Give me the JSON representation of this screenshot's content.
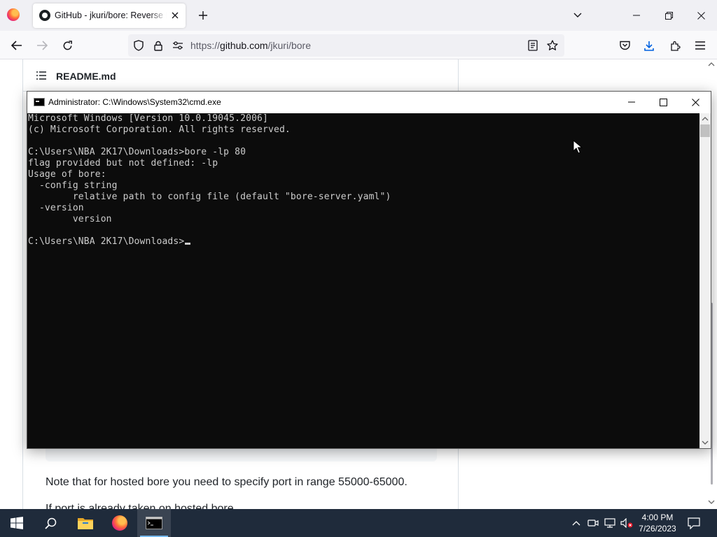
{
  "browser": {
    "tab": {
      "title": "GitHub - jkuri/bore: Reverse HTTP/TCP proxy"
    },
    "url": {
      "prefix": "https://",
      "host": "github.com",
      "path": "/jkuri/bore"
    }
  },
  "page": {
    "readme_title": "README.md",
    "note": "Note that for hosted bore you need to specify port in range 55000-65000.",
    "cut_text": "If port is already taken on hosted bore..."
  },
  "cmd": {
    "title": "Administrator: C:\\Windows\\System32\\cmd.exe",
    "lines": [
      "Microsoft Windows [Version 10.0.19045.2006]",
      "(c) Microsoft Corporation. All rights reserved.",
      "",
      "C:\\Users\\NBA 2K17\\Downloads>bore -lp 80",
      "flag provided but not defined: -lp",
      "Usage of bore:",
      "  -config string",
      "        relative path to config file (default \"bore-server.yaml\")",
      "  -version",
      "        version",
      "",
      "C:\\Users\\NBA 2K17\\Downloads>"
    ]
  },
  "taskbar": {
    "time": "4:00 PM",
    "date": "7/26/2023"
  },
  "colors": {
    "console_bg": "#0c0c0c",
    "console_text": "#cccccc",
    "taskbar_bg": "#1f2b3b",
    "browser_chrome": "#f0f0f4"
  },
  "icons": [
    "firefox-logo-icon",
    "github-favicon-icon",
    "close-icon",
    "plus-icon",
    "chevron-down-icon",
    "minimize-icon",
    "restore-icon",
    "back-arrow-icon",
    "forward-arrow-icon",
    "reload-icon",
    "shield-icon",
    "lock-icon",
    "permissions-icon",
    "reader-view-icon",
    "bookmark-star-icon",
    "pocket-icon",
    "download-icon",
    "extensions-icon",
    "menu-icon",
    "list-icon",
    "cmd-icon",
    "maximize-icon",
    "windows-start-icon",
    "search-icon",
    "file-explorer-icon",
    "firefox-taskbar-icon",
    "terminal-icon",
    "chevron-up-icon",
    "meet-now-icon",
    "network-icon",
    "volume-muted-icon",
    "notification-icon"
  ]
}
